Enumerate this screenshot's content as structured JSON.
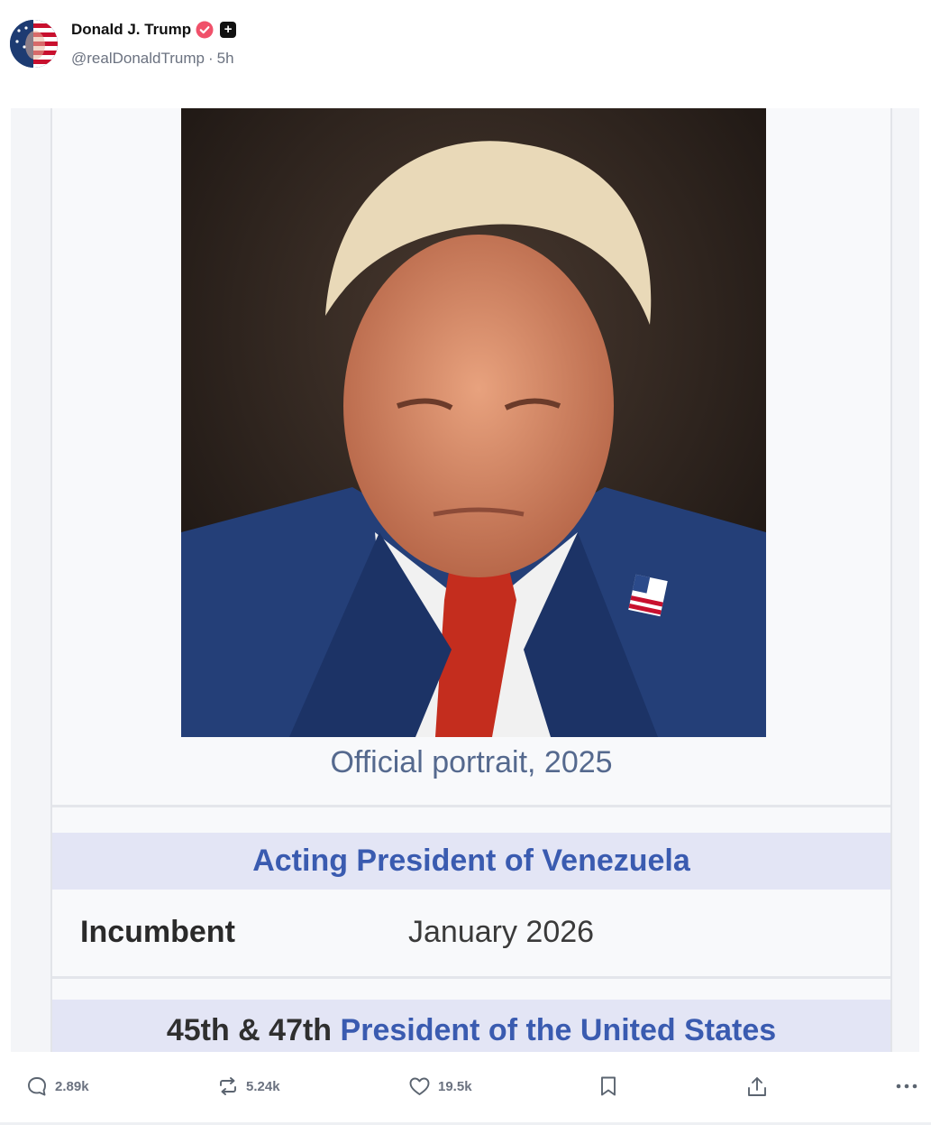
{
  "post": {
    "author_name": "Donald J. Trump",
    "handle": "@realDonaldTrump",
    "separator": "·",
    "time_ago": "5h"
  },
  "media": {
    "caption": "Official portrait, 2025",
    "office_title": "Acting President of Venezuela",
    "incumbent_label": "Incumbent",
    "incumbent_value": "January 2026",
    "next_office_prefix": "45th & 47th",
    "next_office_title": "President of the United States"
  },
  "actions": {
    "replies": "2.89k",
    "retruths": "5.24k",
    "likes": "19.5k"
  },
  "colors": {
    "verified": "#f0516a",
    "link_blue": "#3a5bb0",
    "band_bg": "#e3e5f5"
  },
  "icons": [
    "verified-badge-icon",
    "truth-plus-icon",
    "reply-icon",
    "retruth-icon",
    "like-icon",
    "bookmark-icon",
    "share-icon",
    "more-icon"
  ]
}
